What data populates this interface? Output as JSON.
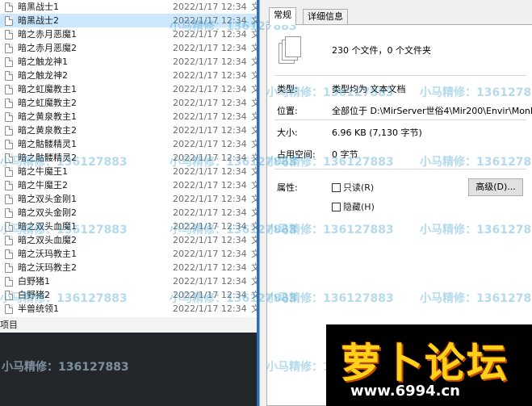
{
  "explorer": {
    "files": [
      {
        "name": "暗黑战士1",
        "date": "2022/1/17 12:34",
        "type": "文",
        "selected": false
      },
      {
        "name": "暗黑战士2",
        "date": "2022/1/17 12:34",
        "type": "文",
        "selected": true
      },
      {
        "name": "暗之赤月恶魔1",
        "date": "2022/1/17 12:34",
        "type": "文",
        "selected": false
      },
      {
        "name": "暗之赤月恶魔2",
        "date": "2022/1/17 12:34",
        "type": "文",
        "selected": false
      },
      {
        "name": "暗之触龙神1",
        "date": "2022/1/17 12:34",
        "type": "文",
        "selected": false
      },
      {
        "name": "暗之触龙神2",
        "date": "2022/1/17 12:34",
        "type": "文",
        "selected": false
      },
      {
        "name": "暗之虹魔教主1",
        "date": "2022/1/17 12:34",
        "type": "文",
        "selected": false
      },
      {
        "name": "暗之虹魔教主2",
        "date": "2022/1/17 12:34",
        "type": "文",
        "selected": false
      },
      {
        "name": "暗之黄泉教主1",
        "date": "2022/1/17 12:34",
        "type": "文",
        "selected": false
      },
      {
        "name": "暗之黄泉教主2",
        "date": "2022/1/17 12:34",
        "type": "文",
        "selected": false
      },
      {
        "name": "暗之骷髅精灵1",
        "date": "2022/1/17 12:34",
        "type": "文",
        "selected": false
      },
      {
        "name": "暗之骷髅精灵2",
        "date": "2022/1/17 12:34",
        "type": "文",
        "selected": false
      },
      {
        "name": "暗之牛魔王1",
        "date": "2022/1/17 12:34",
        "type": "文",
        "selected": false
      },
      {
        "name": "暗之牛魔王2",
        "date": "2022/1/17 12:34",
        "type": "文",
        "selected": false
      },
      {
        "name": "暗之双头金刚1",
        "date": "2022/1/17 12:34",
        "type": "文",
        "selected": false
      },
      {
        "name": "暗之双头金刚2",
        "date": "2022/1/17 12:34",
        "type": "文",
        "selected": false
      },
      {
        "name": "暗之双头血魔1",
        "date": "2022/1/17 12:34",
        "type": "文",
        "selected": false
      },
      {
        "name": "暗之双头血魔2",
        "date": "2022/1/17 12:34",
        "type": "文",
        "selected": false
      },
      {
        "name": "暗之沃玛教主1",
        "date": "2022/1/17 12:34",
        "type": "文",
        "selected": false
      },
      {
        "name": "暗之沃玛教主2",
        "date": "2022/1/17 12:34",
        "type": "文",
        "selected": false
      },
      {
        "name": "白野猪1",
        "date": "2022/1/17 12:34",
        "type": "文",
        "selected": false
      },
      {
        "name": "白野猪2",
        "date": "2022/1/17 12:34",
        "type": "文",
        "selected": false
      },
      {
        "name": "半兽统领1",
        "date": "2022/1/17 12:34",
        "type": "文",
        "selected": false
      }
    ],
    "status_text": "项目"
  },
  "properties": {
    "tabs": [
      "常规",
      "详细信息"
    ],
    "active_tab": "常规",
    "summary": "230 个文件，0 个文件夹",
    "type_label": "类型:",
    "type_value": "类型均为 文本文档",
    "location_label": "位置:",
    "location_value": "全部位于 D:\\MirServer世俗4\\Mir200\\Envir\\MonIco",
    "size_label": "大小:",
    "size_value": "6.96 KB (7,130 字节)",
    "disk_size_label": "占用空间:",
    "disk_size_value": "0 字节",
    "attributes_label": "属性:",
    "readonly_label": "只读(R)",
    "hidden_label": "隐藏(H)",
    "advanced_button": "高级(D)..."
  },
  "watermark": {
    "text": "小马精修：136127883"
  },
  "logo": {
    "title": "萝卜论坛",
    "url": "www.6994.cn"
  },
  "colors": {
    "selection": "#cce8ff",
    "divider": "#2c6fb7",
    "logo_text": "#ffd21a"
  }
}
